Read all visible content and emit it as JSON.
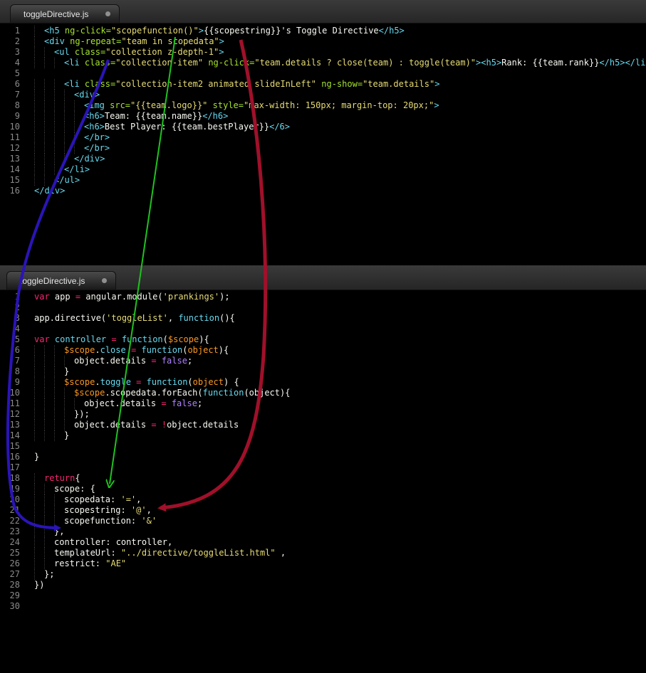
{
  "top_pane": {
    "tab_label": "toggleDirective.js",
    "lines": [
      {
        "n": "1",
        "indent": 1,
        "tokens": [
          [
            "tg",
            "<h5 "
          ],
          [
            "at",
            "ng-click="
          ],
          [
            "st",
            "\"scopefunction()\""
          ],
          [
            "tg",
            ">"
          ],
          [
            "sp",
            "{{scopestring}}'s Toggle Directive"
          ],
          [
            "tg",
            "</h5>"
          ]
        ]
      },
      {
        "n": "2",
        "indent": 1,
        "tokens": [
          [
            "tg",
            "<div "
          ],
          [
            "at",
            "ng-repeat="
          ],
          [
            "st",
            "\"team in scopedata\""
          ],
          [
            "tg",
            ">"
          ]
        ]
      },
      {
        "n": "3",
        "indent": 2,
        "tokens": [
          [
            "tg",
            "<ul "
          ],
          [
            "at",
            "class="
          ],
          [
            "st",
            "\"collection z-depth-1\""
          ],
          [
            "tg",
            ">"
          ]
        ]
      },
      {
        "n": "4",
        "indent": 3,
        "tokens": [
          [
            "tg",
            "<li "
          ],
          [
            "at",
            "class="
          ],
          [
            "st",
            "\"collection-item\""
          ],
          [
            "sp",
            " "
          ],
          [
            "at",
            "ng-click="
          ],
          [
            "st",
            "\"team.details ? close(team) : toggle(team)\""
          ],
          [
            "tg",
            ">"
          ],
          [
            "tg",
            "<h5>"
          ],
          [
            "sp",
            "Rank: {{team.rank}}"
          ],
          [
            "tg",
            "</h5>"
          ],
          [
            "tg",
            "</li>"
          ]
        ]
      },
      {
        "n": "5",
        "indent": 0,
        "tokens": []
      },
      {
        "n": "6",
        "indent": 3,
        "tokens": [
          [
            "tg",
            "<li "
          ],
          [
            "at",
            "class="
          ],
          [
            "st",
            "\"collection-item2 animated slideInLeft\""
          ],
          [
            "sp",
            " "
          ],
          [
            "at",
            "ng-show="
          ],
          [
            "st",
            "\"team.details\""
          ],
          [
            "tg",
            ">"
          ]
        ]
      },
      {
        "n": "7",
        "indent": 4,
        "tokens": [
          [
            "tg",
            "<div>"
          ]
        ]
      },
      {
        "n": "8",
        "indent": 5,
        "tokens": [
          [
            "tg",
            "<img "
          ],
          [
            "at",
            "src="
          ],
          [
            "st",
            "\"{{team.logo}}\""
          ],
          [
            "sp",
            " "
          ],
          [
            "at",
            "style="
          ],
          [
            "st",
            "\"max-width: 150px; margin-top: 20px;\""
          ],
          [
            "tg",
            ">"
          ]
        ]
      },
      {
        "n": "9",
        "indent": 5,
        "tokens": [
          [
            "tg",
            "<h6>"
          ],
          [
            "sp",
            "Team: {{team.name}}"
          ],
          [
            "tg",
            "</h6>"
          ]
        ]
      },
      {
        "n": "10",
        "indent": 5,
        "tokens": [
          [
            "tg",
            "<h6>"
          ],
          [
            "sp",
            "Best Player: {{team.bestPlayer}}"
          ],
          [
            "tg",
            "</6>"
          ]
        ]
      },
      {
        "n": "11",
        "indent": 5,
        "tokens": [
          [
            "tg",
            "</br>"
          ]
        ]
      },
      {
        "n": "12",
        "indent": 5,
        "tokens": [
          [
            "tg",
            "</br>"
          ]
        ]
      },
      {
        "n": "13",
        "indent": 4,
        "tokens": [
          [
            "tg",
            "</div>"
          ]
        ]
      },
      {
        "n": "14",
        "indent": 3,
        "tokens": [
          [
            "tg",
            "</li>"
          ]
        ]
      },
      {
        "n": "15",
        "indent": 2,
        "tokens": [
          [
            "tg",
            "</ul>"
          ]
        ]
      },
      {
        "n": "16",
        "indent": 0,
        "tokens": [
          [
            "tg",
            "</div>"
          ]
        ]
      }
    ]
  },
  "bottom_pane": {
    "tab_label": "toggleDirective.js",
    "lines": [
      {
        "n": "1",
        "indent": 0,
        "tokens": [
          [
            "kw",
            "var "
          ],
          [
            "sp",
            "app "
          ],
          [
            "kw",
            "= "
          ],
          [
            "sp",
            "angular.module("
          ],
          [
            "st",
            "'prankings'"
          ],
          [
            "sp",
            ");"
          ]
        ]
      },
      {
        "n": "2",
        "indent": 0,
        "tokens": []
      },
      {
        "n": "3",
        "indent": 0,
        "tokens": [
          [
            "sp",
            "app.directive("
          ],
          [
            "st",
            "'toggleList'"
          ],
          [
            "sp",
            ", "
          ],
          [
            "fn",
            "function"
          ],
          [
            "sp",
            "(){"
          ]
        ]
      },
      {
        "n": "4",
        "indent": 0,
        "tokens": []
      },
      {
        "n": "5",
        "indent": 0,
        "tokens": [
          [
            "kw",
            "var "
          ],
          [
            "fn",
            "controller "
          ],
          [
            "kw",
            "= "
          ],
          [
            "fn",
            "function"
          ],
          [
            "sp",
            "("
          ],
          [
            "va",
            "$scope"
          ],
          [
            "sp",
            "){"
          ]
        ]
      },
      {
        "n": "6",
        "indent": 3,
        "tokens": [
          [
            "va",
            "$scope"
          ],
          [
            "sp",
            "."
          ],
          [
            "fn",
            "close "
          ],
          [
            "kw",
            "= "
          ],
          [
            "fn",
            "function"
          ],
          [
            "sp",
            "("
          ],
          [
            "va",
            "object"
          ],
          [
            "sp",
            "){"
          ]
        ]
      },
      {
        "n": "7",
        "indent": 4,
        "tokens": [
          [
            "sp",
            "object.details "
          ],
          [
            "kw",
            "= "
          ],
          [
            "nm",
            "false"
          ],
          [
            "sp",
            ";"
          ]
        ]
      },
      {
        "n": "8",
        "indent": 3,
        "tokens": [
          [
            "sp",
            "}"
          ]
        ]
      },
      {
        "n": "9",
        "indent": 3,
        "tokens": [
          [
            "va",
            "$scope"
          ],
          [
            "sp",
            "."
          ],
          [
            "fn",
            "toggle "
          ],
          [
            "kw",
            "= "
          ],
          [
            "fn",
            "function"
          ],
          [
            "sp",
            "("
          ],
          [
            "va",
            "object"
          ],
          [
            "sp",
            ") {"
          ]
        ]
      },
      {
        "n": "10",
        "indent": 4,
        "tokens": [
          [
            "va",
            "$scope"
          ],
          [
            "sp",
            ".scopedata.forEach("
          ],
          [
            "fn",
            "function"
          ],
          [
            "sp",
            "(object){"
          ]
        ]
      },
      {
        "n": "11",
        "indent": 5,
        "tokens": [
          [
            "sp",
            "object.details "
          ],
          [
            "kw",
            "= "
          ],
          [
            "nm",
            "false"
          ],
          [
            "sp",
            ";"
          ]
        ]
      },
      {
        "n": "12",
        "indent": 4,
        "tokens": [
          [
            "sp",
            "});"
          ]
        ]
      },
      {
        "n": "13",
        "indent": 4,
        "tokens": [
          [
            "sp",
            "object.details "
          ],
          [
            "kw",
            "= !"
          ],
          [
            "sp",
            "object.details"
          ]
        ]
      },
      {
        "n": "14",
        "indent": 3,
        "tokens": [
          [
            "sp",
            "}"
          ]
        ]
      },
      {
        "n": "15",
        "indent": 0,
        "tokens": []
      },
      {
        "n": "16",
        "indent": 0,
        "tokens": [
          [
            "sp",
            "}"
          ]
        ]
      },
      {
        "n": "17",
        "indent": 0,
        "tokens": []
      },
      {
        "n": "18",
        "indent": 1,
        "tokens": [
          [
            "kw",
            "return"
          ],
          [
            "sp",
            "{"
          ]
        ]
      },
      {
        "n": "19",
        "indent": 2,
        "tokens": [
          [
            "sp",
            "scope: {"
          ]
        ]
      },
      {
        "n": "20",
        "indent": 3,
        "tokens": [
          [
            "sp",
            "scopedata: "
          ],
          [
            "st",
            "'='"
          ],
          [
            "sp",
            ","
          ]
        ]
      },
      {
        "n": "21",
        "indent": 3,
        "tokens": [
          [
            "sp",
            "scopestring: "
          ],
          [
            "st",
            "'@'"
          ],
          [
            "sp",
            ","
          ]
        ]
      },
      {
        "n": "22",
        "indent": 3,
        "tokens": [
          [
            "sp",
            "scopefunction: "
          ],
          [
            "st",
            "'&'"
          ]
        ]
      },
      {
        "n": "23",
        "indent": 2,
        "tokens": [
          [
            "sp",
            "},"
          ]
        ]
      },
      {
        "n": "24",
        "indent": 2,
        "tokens": [
          [
            "sp",
            "controller: controller,"
          ]
        ]
      },
      {
        "n": "25",
        "indent": 2,
        "tokens": [
          [
            "sp",
            "templateUrl: "
          ],
          [
            "st",
            "\"../directive/toggleList.html\""
          ],
          [
            "sp",
            " ,"
          ]
        ]
      },
      {
        "n": "26",
        "indent": 2,
        "tokens": [
          [
            "sp",
            "restrict: "
          ],
          [
            "st",
            "\"AE\""
          ]
        ]
      },
      {
        "n": "27",
        "indent": 1,
        "tokens": [
          [
            "sp",
            "};"
          ]
        ]
      },
      {
        "n": "28",
        "indent": 0,
        "tokens": [
          [
            "sp",
            "})"
          ]
        ]
      },
      {
        "n": "29",
        "indent": 0,
        "tokens": []
      },
      {
        "n": "30",
        "indent": 0,
        "tokens": [],
        "current": true
      }
    ]
  },
  "annotations": {
    "arrows": [
      {
        "color": "#2a14b8",
        "from": "scopedata (html line 2)",
        "to": "scopedata (js line 20)"
      },
      {
        "color": "#1fc21f",
        "from": "scopefunction (html line 1)",
        "to": "scopefunction (js line 22)"
      },
      {
        "color": "#a0102a",
        "from": "scopestring (html line 1)",
        "to": "scopestring (js line 21)"
      }
    ]
  },
  "colors": {
    "background": "#000000",
    "tag": "#66d9ef",
    "attr": "#a6e22e",
    "string": "#e6db74",
    "keyword": "#f92672"
  }
}
